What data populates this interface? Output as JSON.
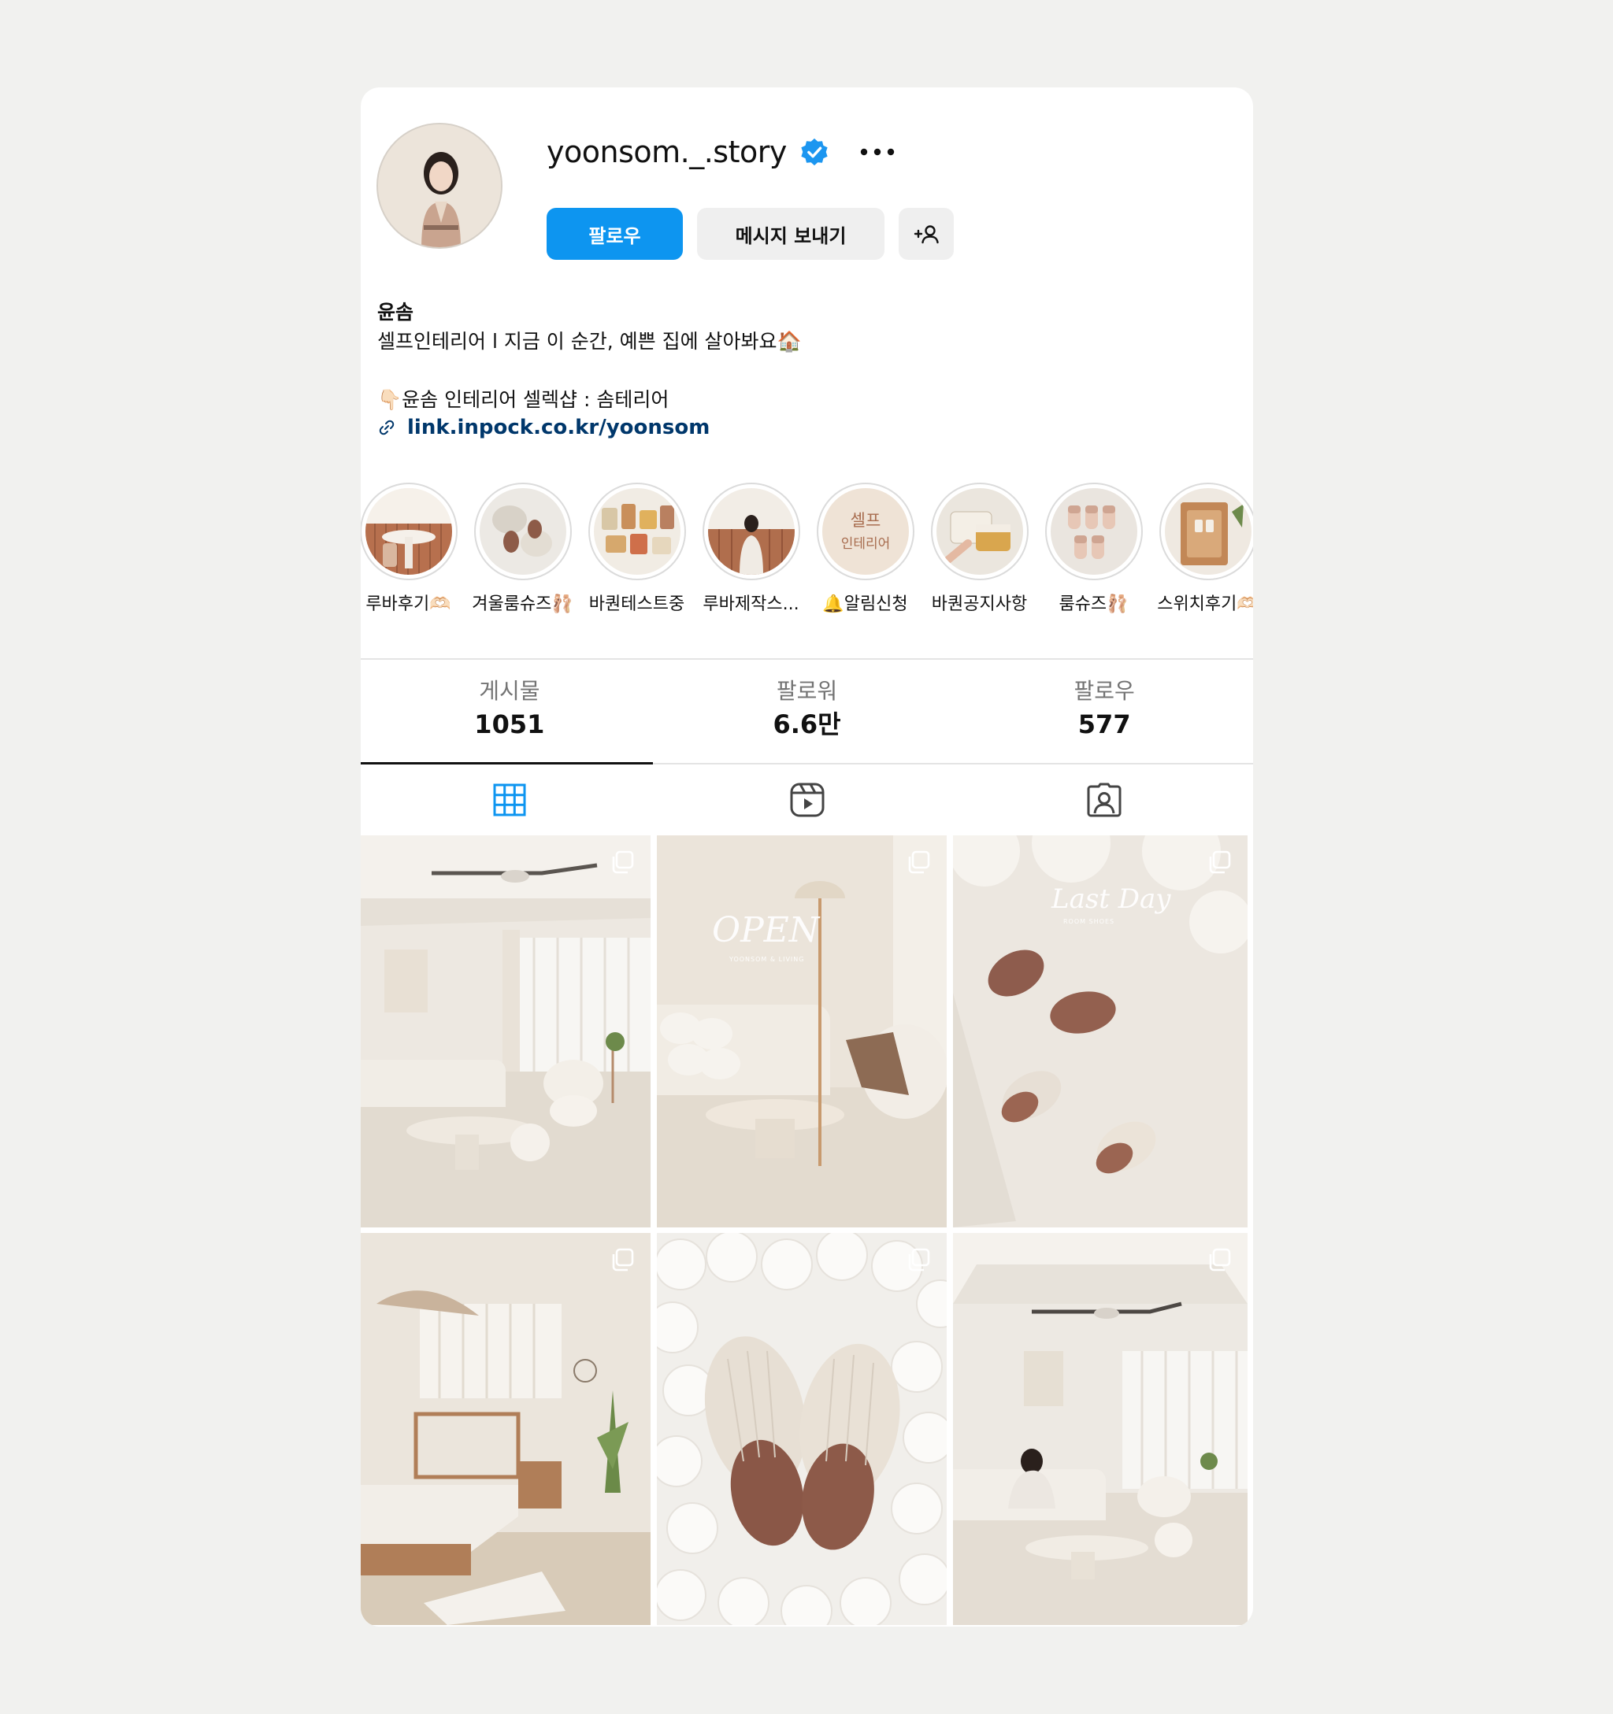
{
  "profile": {
    "username": "yoonsom._.story",
    "verified": true,
    "name": "윤솜",
    "bio_line1": "셀프인테리어 l 지금 이 순간, 예쁜 집에 살아봐요🏠",
    "bio_line2": "👇🏻윤솜 인테리어 셀렉샵 : 솜테리어",
    "link": "link.inpock.co.kr/yoonsom"
  },
  "buttons": {
    "follow": "팔로우",
    "message": "메시지 보내기"
  },
  "highlights": [
    {
      "label": "루바후기🫶🏻"
    },
    {
      "label": "겨울룸슈즈🩰"
    },
    {
      "label": "바퀀테스트중"
    },
    {
      "label": "루바제작스..."
    },
    {
      "label": "🔔알림신청",
      "cover_text": "셀프\n인테리어"
    },
    {
      "label": "바퀀공지사항"
    },
    {
      "label": "룸슈즈🩰"
    },
    {
      "label": "스위치후기🫶🏻"
    }
  ],
  "stats": [
    {
      "label": "게시물",
      "value": "1051"
    },
    {
      "label": "팔로워",
      "value": "6.6만"
    },
    {
      "label": "팔로우",
      "value": "577"
    }
  ],
  "posts": [
    {
      "overlay_title": "",
      "overlay_sub": ""
    },
    {
      "overlay_title": "OPEN",
      "overlay_sub": "YOONSOM & LIVING"
    },
    {
      "overlay_title": "Last Day",
      "overlay_sub": "ROOM SHOES"
    },
    {
      "overlay_title": "",
      "overlay_sub": ""
    },
    {
      "overlay_title": "",
      "overlay_sub": ""
    },
    {
      "overlay_title": "",
      "overlay_sub": ""
    }
  ],
  "colors": {
    "accent": "#0d95f0",
    "verified": "#1c96f0",
    "link": "#00376b",
    "muted": "#737373"
  },
  "icons": {
    "verified": "verified-badge-icon",
    "more": "more-horizontal-icon",
    "add_person": "add-person-icon",
    "link": "link-icon",
    "tab_grid": "grid-icon",
    "tab_reels": "reels-icon",
    "tab_tagged": "tagged-icon",
    "multi_post": "carousel-icon"
  }
}
